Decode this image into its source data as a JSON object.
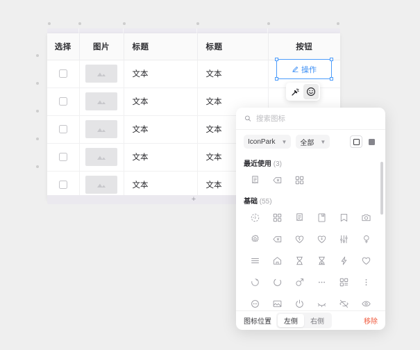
{
  "canvas": {
    "background": "#efefef"
  },
  "table": {
    "columns": [
      "选择",
      "图片",
      "标题",
      "标题",
      "按钮"
    ],
    "rows": [
      {
        "checkbox": "",
        "image": "image-placeholder",
        "title1": "文本",
        "title2": "文本",
        "button": "操作"
      },
      {
        "checkbox": "",
        "image": "image-placeholder",
        "title1": "文本",
        "title2": "文本",
        "button": ""
      },
      {
        "checkbox": "",
        "image": "image-placeholder",
        "title1": "文本",
        "title2": "文本",
        "button": ""
      },
      {
        "checkbox": "",
        "image": "image-placeholder",
        "title1": "文本",
        "title2": "文本",
        "button": ""
      },
      {
        "checkbox": "",
        "image": "image-placeholder",
        "title1": "文本",
        "title2": "文本",
        "button": ""
      }
    ],
    "add_row_label": "+"
  },
  "selection": {
    "button_label": "操作",
    "button_icon": "pencil-icon",
    "accent_color": "#3b8ef5"
  },
  "mini_toolbar": {
    "items": [
      {
        "name": "magic-wand-icon",
        "active": false
      },
      {
        "name": "emoji-icon",
        "active": true
      }
    ]
  },
  "icon_picker": {
    "search": {
      "placeholder": "搜索图标",
      "value": ""
    },
    "library_select": {
      "value": "IconPark"
    },
    "category_select": {
      "value": "全部"
    },
    "style_toggles": [
      {
        "name": "outline-style-toggle",
        "active": true
      },
      {
        "name": "filled-style-toggle",
        "active": false
      }
    ],
    "groups": [
      {
        "title": "最近使用",
        "count": "(3)",
        "icons": [
          "document-icon",
          "backspace-icon",
          "grid-icon"
        ]
      },
      {
        "title": "基础",
        "count": "(55)",
        "icons": [
          "dashed-circle-icon",
          "grid-icon",
          "document-icon",
          "book-icon",
          "bookmark-icon",
          "camera-icon",
          "gear-icon",
          "backspace-icon",
          "broken-heart-icon",
          "heart-star-icon",
          "sliders-icon",
          "search-female-icon",
          "menu-icon",
          "home-icon",
          "hourglass-icon",
          "hourglass-end-icon",
          "lightning-icon",
          "heart-icon",
          "loading-icon",
          "loading-arc-icon",
          "male-icon",
          "ellipsis-icon",
          "qr-code-icon",
          "more-vertical-icon",
          "chat-bubble-icon",
          "image-icon",
          "power-icon",
          "eye-closed-icon",
          "eye-off-icon",
          "eye-icon"
        ]
      }
    ],
    "footer": {
      "position_label": "图标位置",
      "segments": [
        {
          "label": "左侧",
          "active": true
        },
        {
          "label": "右侧",
          "active": false
        }
      ],
      "remove_label": "移除",
      "remove_color": "#f0593c"
    }
  }
}
